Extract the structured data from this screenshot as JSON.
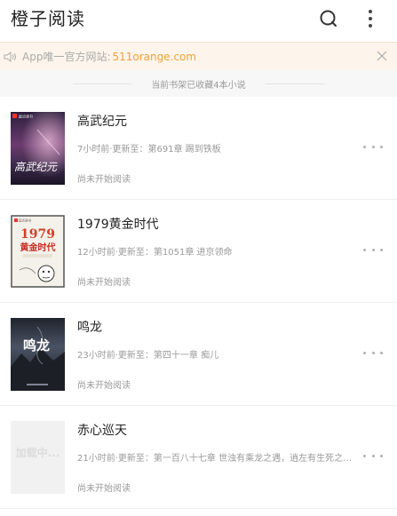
{
  "app": {
    "title": "橙子阅读"
  },
  "notice": {
    "text": "App唯一官方网站:",
    "url": "511orange.com"
  },
  "shelf": {
    "count_text": "当前书架已收藏4本小说"
  },
  "books": [
    {
      "title": "高武纪元",
      "update": "7小时前·更新至：第691章 踢到铁板",
      "status": "尚未开始阅读",
      "cover_text": "高武纪元",
      "cover_publisher": "起点读书"
    },
    {
      "title": "1979黄金时代",
      "update": "12小时前·更新至：第1051章 进京领命",
      "status": "尚未开始阅读",
      "cover_year": "1979",
      "cover_text": "黄金时代",
      "cover_publisher": "起点读书"
    },
    {
      "title": "鸣龙",
      "update": "23小时前·更新至：第四十一章 痴儿",
      "status": "尚未开始阅读",
      "cover_text": "鸣龙"
    },
    {
      "title": "赤心巡天",
      "update": "21小时前·更新至：第一百八十七章 世浊有乘龙之遇，逍左有生死之…",
      "status": "尚未开始阅读",
      "cover_text": "加载中..."
    }
  ],
  "colors": {
    "accent": "#f2a13a",
    "notice_bg": "#fdf5ec",
    "strip_bg": "#f7f7f7"
  }
}
